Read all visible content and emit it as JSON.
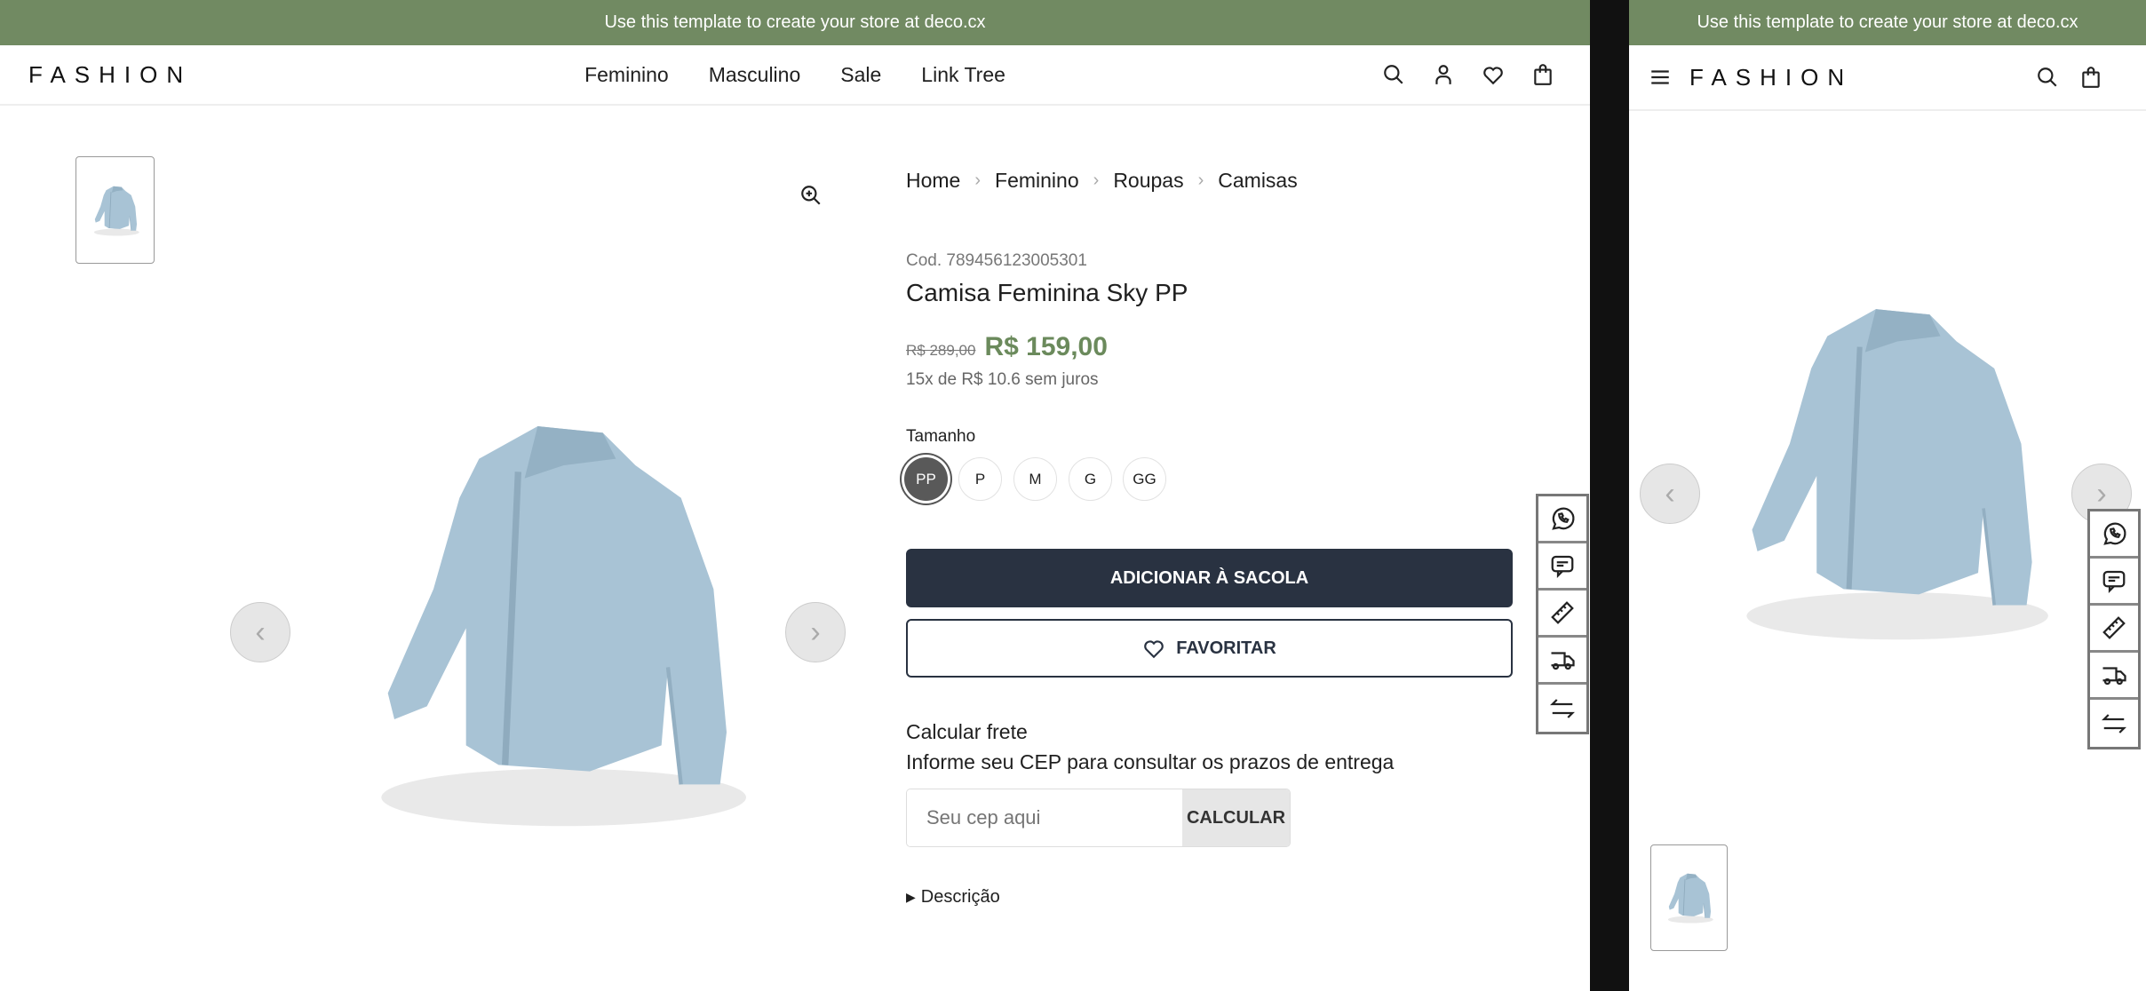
{
  "banner": {
    "text": "Use this template to create your store at deco.cx"
  },
  "header": {
    "logo": "FASHION",
    "nav": [
      "Feminino",
      "Masculino",
      "Sale",
      "Link Tree"
    ],
    "icons": [
      "search-icon",
      "user-icon",
      "heart-icon",
      "bag-icon"
    ]
  },
  "breadcrumb": [
    "Home",
    "Feminino",
    "Roupas",
    "Camisas"
  ],
  "product": {
    "code": "Cod. 789456123005301",
    "name": "Camisa Feminina Sky PP",
    "list_price": "R$ 289,00",
    "price": "R$ 159,00",
    "installments": "15x de R$ 10.6 sem juros",
    "size_label": "Tamanho",
    "sizes": [
      "PP",
      "P",
      "M",
      "G",
      "GG"
    ],
    "selected_size": "PP"
  },
  "actions": {
    "add_to_bag": "ADICIONAR À SACOLA",
    "favorite": "FAVORITAR"
  },
  "shipping": {
    "title": "Calcular frete",
    "subtitle": "Informe seu CEP para consultar os prazos de entrega",
    "placeholder": "Seu cep aqui",
    "button": "CALCULAR"
  },
  "description": {
    "label": "Descrição"
  },
  "side_tools": [
    "whatsapp-icon",
    "chat-icon",
    "ruler-icon",
    "truck-icon",
    "swap-icon"
  ],
  "colors": {
    "banner": "#718a62",
    "price": "#6b8a5c",
    "primary_button": "#293241"
  }
}
